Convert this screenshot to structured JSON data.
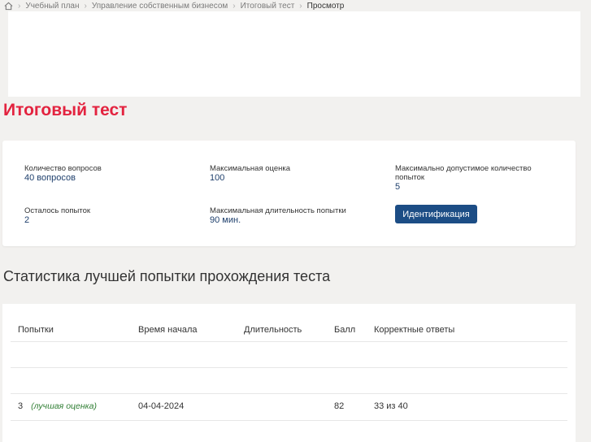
{
  "breadcrumb": {
    "home_icon": "home-icon",
    "items": [
      "Учебный план",
      "Управление собственным бизнесом",
      "Итоговый тест",
      "Просмотр"
    ]
  },
  "page_title": "Итоговый тест",
  "info": {
    "questions_label": "Количество вопросов",
    "questions_value": "40 вопросов",
    "max_score_label": "Максимальная оценка",
    "max_score_value": "100",
    "max_attempts_label": "Максимально допустимое количество попыток",
    "max_attempts_value": "5",
    "attempts_left_label": "Осталось попыток",
    "attempts_left_value": "2",
    "max_duration_label": "Максимальная длительность попытки",
    "max_duration_value": "90 мин.",
    "ident_button": "Идентификация"
  },
  "stats": {
    "title": "Статистика лучшей попытки прохождения теста",
    "columns": [
      "Попытки",
      "Время начала",
      "Длительность",
      "Балл",
      "Корректные ответы"
    ],
    "best": {
      "attempt": "3",
      "note": "(лучшая оценка)",
      "start": "04-04-2024",
      "duration": "",
      "score": "82",
      "correct": "33 из 40"
    }
  },
  "colors": {
    "accent": "#e3233f",
    "button": "#1c4d85",
    "value_text": "#1e3f6c",
    "best_note": "#2e7d32"
  }
}
